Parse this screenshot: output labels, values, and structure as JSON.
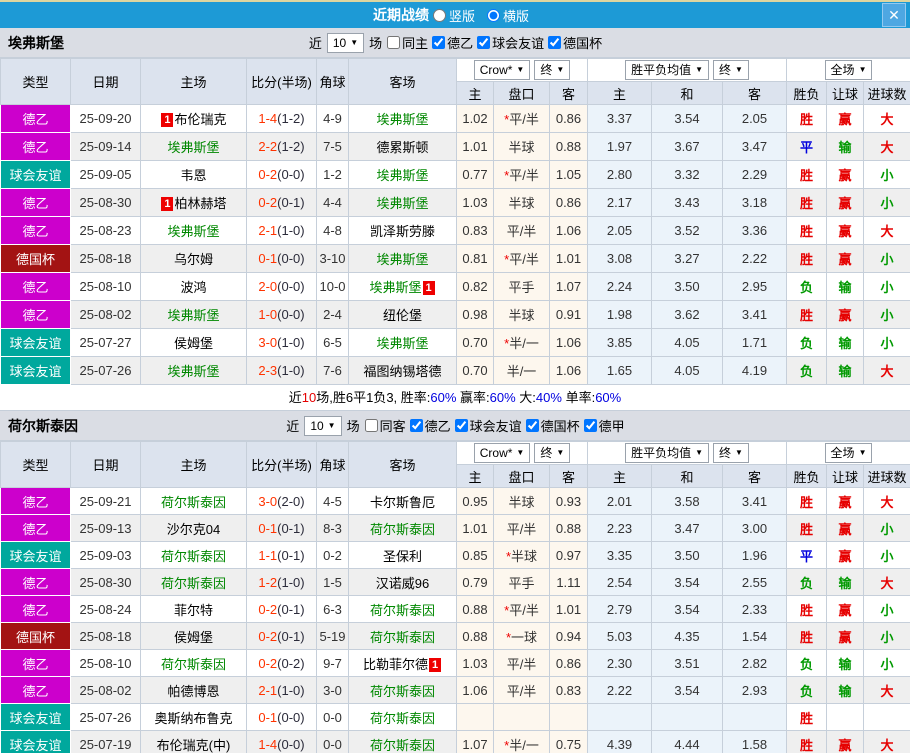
{
  "titlebar": {
    "title": "近期战绩",
    "radios": [
      {
        "label": "竖版",
        "checked": false
      },
      {
        "label": "横版",
        "checked": true
      }
    ],
    "close_label": "✕"
  },
  "table_header": {
    "left_cols": [
      "类型",
      "日期",
      "主场",
      "比分(半场)",
      "角球",
      "客场"
    ],
    "groups": [
      {
        "dropdowns": [
          "Crow*",
          "终"
        ],
        "cols": [
          "主",
          "盘口",
          "客"
        ]
      },
      {
        "dropdowns": [
          "胜平负均值",
          "终"
        ],
        "cols": [
          "主",
          "和",
          "客"
        ]
      },
      {
        "dropdowns": [
          "全场"
        ],
        "cols": [
          "胜负",
          "让球",
          "进球数"
        ]
      }
    ]
  },
  "colors": {
    "titlebar_bg": "#1d9ad6",
    "type": {
      "德乙": "#cc00cc",
      "球会友谊": "#00a89d",
      "德国杯": "#a31313",
      "德甲": "#e07000"
    },
    "team_green": "#008800",
    "team_black": "#000000",
    "score_red": "#ff3300",
    "outcome": {
      "胜": "#e60000",
      "平": "#0000dd",
      "负": "#009900",
      "赢": "#e60000",
      "输": "#009900",
      "大": "#e60000",
      "小": "#009900"
    },
    "summary_value_blue": "#0000e0",
    "odds_bg": "#fdf7ee",
    "avg_bg": "#ebf3fa"
  },
  "sections": [
    {
      "team": "埃弗斯堡",
      "filters": {
        "near_label": "近",
        "count": "10",
        "games_label": "场",
        "same_label": "同主",
        "same_checked": false,
        "leagues": [
          {
            "label": "德乙",
            "checked": true
          },
          {
            "label": "球会友谊",
            "checked": true
          },
          {
            "label": "德国杯",
            "checked": true
          }
        ]
      },
      "rows": [
        {
          "type": "德乙",
          "date": "25-09-20",
          "home": "布伦瑞克",
          "home_green": false,
          "home_badge": "1",
          "score": "1-4",
          "half": "(1-2)",
          "corners": "4-9",
          "away": "埃弗斯堡",
          "away_green": true,
          "away_badge": "",
          "odds": [
            "1.02",
            "*平/半",
            "0.86"
          ],
          "avg": [
            "3.37",
            "3.54",
            "2.05"
          ],
          "results": [
            "胜",
            "赢",
            "大"
          ]
        },
        {
          "type": "德乙",
          "date": "25-09-14",
          "home": "埃弗斯堡",
          "home_green": true,
          "home_badge": "",
          "score": "2-2",
          "half": "(1-2)",
          "corners": "7-5",
          "away": "德累斯顿",
          "away_green": false,
          "away_badge": "",
          "odds": [
            "1.01",
            "半球",
            "0.88"
          ],
          "avg": [
            "1.97",
            "3.67",
            "3.47"
          ],
          "results": [
            "平",
            "输",
            "大"
          ]
        },
        {
          "type": "球会友谊",
          "date": "25-09-05",
          "home": "韦恩",
          "home_green": false,
          "home_badge": "",
          "score": "0-2",
          "half": "(0-0)",
          "corners": "1-2",
          "away": "埃弗斯堡",
          "away_green": true,
          "away_badge": "",
          "odds": [
            "0.77",
            "*平/半",
            "1.05"
          ],
          "avg": [
            "2.80",
            "3.32",
            "2.29"
          ],
          "results": [
            "胜",
            "赢",
            "小"
          ]
        },
        {
          "type": "德乙",
          "date": "25-08-30",
          "home": "柏林赫塔",
          "home_green": false,
          "home_badge": "1",
          "score": "0-2",
          "half": "(0-1)",
          "corners": "4-4",
          "away": "埃弗斯堡",
          "away_green": true,
          "away_badge": "",
          "odds": [
            "1.03",
            "半球",
            "0.86"
          ],
          "avg": [
            "2.17",
            "3.43",
            "3.18"
          ],
          "results": [
            "胜",
            "赢",
            "小"
          ]
        },
        {
          "type": "德乙",
          "date": "25-08-23",
          "home": "埃弗斯堡",
          "home_green": true,
          "home_badge": "",
          "score": "2-1",
          "half": "(1-0)",
          "corners": "4-8",
          "away": "凯泽斯劳滕",
          "away_green": false,
          "away_badge": "",
          "odds": [
            "0.83",
            "平/半",
            "1.06"
          ],
          "avg": [
            "2.05",
            "3.52",
            "3.36"
          ],
          "results": [
            "胜",
            "赢",
            "大"
          ]
        },
        {
          "type": "德国杯",
          "date": "25-08-18",
          "home": "乌尔姆",
          "home_green": false,
          "home_badge": "",
          "score": "0-1",
          "half": "(0-0)",
          "corners": "3-10",
          "away": "埃弗斯堡",
          "away_green": true,
          "away_badge": "",
          "odds": [
            "0.81",
            "*平/半",
            "1.01"
          ],
          "avg": [
            "3.08",
            "3.27",
            "2.22"
          ],
          "results": [
            "胜",
            "赢",
            "小"
          ]
        },
        {
          "type": "德乙",
          "date": "25-08-10",
          "home": "波鸿",
          "home_green": false,
          "home_badge": "",
          "score": "2-0",
          "half": "(0-0)",
          "corners": "10-0",
          "away": "埃弗斯堡",
          "away_green": true,
          "away_badge": "1",
          "odds": [
            "0.82",
            "平手",
            "1.07"
          ],
          "avg": [
            "2.24",
            "3.50",
            "2.95"
          ],
          "results": [
            "负",
            "输",
            "小"
          ]
        },
        {
          "type": "德乙",
          "date": "25-08-02",
          "home": "埃弗斯堡",
          "home_green": true,
          "home_badge": "",
          "score": "1-0",
          "half": "(0-0)",
          "corners": "2-4",
          "away": "纽伦堡",
          "away_green": false,
          "away_badge": "",
          "odds": [
            "0.98",
            "半球",
            "0.91"
          ],
          "avg": [
            "1.98",
            "3.62",
            "3.41"
          ],
          "results": [
            "胜",
            "赢",
            "小"
          ]
        },
        {
          "type": "球会友谊",
          "date": "25-07-27",
          "home": "侯姆堡",
          "home_green": false,
          "home_badge": "",
          "score": "3-0",
          "half": "(1-0)",
          "corners": "6-5",
          "away": "埃弗斯堡",
          "away_green": true,
          "away_badge": "",
          "odds": [
            "0.70",
            "*半/一",
            "1.06"
          ],
          "avg": [
            "3.85",
            "4.05",
            "1.71"
          ],
          "results": [
            "负",
            "输",
            "小"
          ]
        },
        {
          "type": "球会友谊",
          "date": "25-07-26",
          "home": "埃弗斯堡",
          "home_green": true,
          "home_badge": "",
          "score": "2-3",
          "half": "(1-0)",
          "corners": "7-6",
          "away": "福图纳锡塔德",
          "away_green": false,
          "away_badge": "",
          "odds": [
            "0.70",
            "半/一",
            "1.06"
          ],
          "avg": [
            "1.65",
            "4.05",
            "4.19"
          ],
          "results": [
            "负",
            "输",
            "大"
          ]
        }
      ],
      "summary_segments": [
        {
          "t": "近",
          "c": "k"
        },
        {
          "t": "10",
          "c": "r"
        },
        {
          "t": "场,胜6平1负3, 胜率:",
          "c": "k"
        },
        {
          "t": "60%",
          "c": "b"
        },
        {
          "t": " 赢率:",
          "c": "k"
        },
        {
          "t": "60%",
          "c": "b"
        },
        {
          "t": " 大:",
          "c": "k"
        },
        {
          "t": "40%",
          "c": "b"
        },
        {
          "t": " 单率:",
          "c": "k"
        },
        {
          "t": "60%",
          "c": "b"
        }
      ]
    },
    {
      "team": "荷尔斯泰因",
      "filters": {
        "near_label": "近",
        "count": "10",
        "games_label": "场",
        "same_label": "同客",
        "same_checked": false,
        "leagues": [
          {
            "label": "德乙",
            "checked": true
          },
          {
            "label": "球会友谊",
            "checked": true
          },
          {
            "label": "德国杯",
            "checked": true
          },
          {
            "label": "德甲",
            "checked": true
          }
        ]
      },
      "rows": [
        {
          "type": "德乙",
          "date": "25-09-21",
          "home": "荷尔斯泰因",
          "home_green": true,
          "home_badge": "",
          "score": "3-0",
          "half": "(2-0)",
          "corners": "4-5",
          "away": "卡尔斯鲁厄",
          "away_green": false,
          "away_badge": "",
          "odds": [
            "0.95",
            "半球",
            "0.93"
          ],
          "avg": [
            "2.01",
            "3.58",
            "3.41"
          ],
          "results": [
            "胜",
            "赢",
            "大"
          ]
        },
        {
          "type": "德乙",
          "date": "25-09-13",
          "home": "沙尔克04",
          "home_green": false,
          "home_badge": "",
          "score": "0-1",
          "half": "(0-1)",
          "corners": "8-3",
          "away": "荷尔斯泰因",
          "away_green": true,
          "away_badge": "",
          "odds": [
            "1.01",
            "平/半",
            "0.88"
          ],
          "avg": [
            "2.23",
            "3.47",
            "3.00"
          ],
          "results": [
            "胜",
            "赢",
            "小"
          ]
        },
        {
          "type": "球会友谊",
          "date": "25-09-03",
          "home": "荷尔斯泰因",
          "home_green": true,
          "home_badge": "",
          "score": "1-1",
          "half": "(0-1)",
          "corners": "0-2",
          "away": "圣保利",
          "away_green": false,
          "away_badge": "",
          "odds": [
            "0.85",
            "*半球",
            "0.97"
          ],
          "avg": [
            "3.35",
            "3.50",
            "1.96"
          ],
          "results": [
            "平",
            "赢",
            "小"
          ]
        },
        {
          "type": "德乙",
          "date": "25-08-30",
          "home": "荷尔斯泰因",
          "home_green": true,
          "home_badge": "",
          "score": "1-2",
          "half": "(1-0)",
          "corners": "1-5",
          "away": "汉诺威96",
          "away_green": false,
          "away_badge": "",
          "odds": [
            "0.79",
            "平手",
            "1.11"
          ],
          "avg": [
            "2.54",
            "3.54",
            "2.55"
          ],
          "results": [
            "负",
            "输",
            "大"
          ]
        },
        {
          "type": "德乙",
          "date": "25-08-24",
          "home": "菲尔特",
          "home_green": false,
          "home_badge": "",
          "score": "0-2",
          "half": "(0-1)",
          "corners": "6-3",
          "away": "荷尔斯泰因",
          "away_green": true,
          "away_badge": "",
          "odds": [
            "0.88",
            "*平/半",
            "1.01"
          ],
          "avg": [
            "2.79",
            "3.54",
            "2.33"
          ],
          "results": [
            "胜",
            "赢",
            "小"
          ]
        },
        {
          "type": "德国杯",
          "date": "25-08-18",
          "home": "侯姆堡",
          "home_green": false,
          "home_badge": "",
          "score": "0-2",
          "half": "(0-1)",
          "corners": "5-19",
          "away": "荷尔斯泰因",
          "away_green": true,
          "away_badge": "",
          "odds": [
            "0.88",
            "*一球",
            "0.94"
          ],
          "avg": [
            "5.03",
            "4.35",
            "1.54"
          ],
          "results": [
            "胜",
            "赢",
            "小"
          ]
        },
        {
          "type": "德乙",
          "date": "25-08-10",
          "home": "荷尔斯泰因",
          "home_green": true,
          "home_badge": "",
          "score": "0-2",
          "half": "(0-2)",
          "corners": "9-7",
          "away": "比勒菲尔德",
          "away_green": false,
          "away_badge": "1",
          "odds": [
            "1.03",
            "平/半",
            "0.86"
          ],
          "avg": [
            "2.30",
            "3.51",
            "2.82"
          ],
          "results": [
            "负",
            "输",
            "小"
          ]
        },
        {
          "type": "德乙",
          "date": "25-08-02",
          "home": "帕德博恩",
          "home_green": false,
          "home_badge": "",
          "score": "2-1",
          "half": "(1-0)",
          "corners": "3-0",
          "away": "荷尔斯泰因",
          "away_green": true,
          "away_badge": "",
          "odds": [
            "1.06",
            "平/半",
            "0.83"
          ],
          "avg": [
            "2.22",
            "3.54",
            "2.93"
          ],
          "results": [
            "负",
            "输",
            "大"
          ]
        },
        {
          "type": "球会友谊",
          "date": "25-07-26",
          "home": "奥斯纳布鲁克",
          "home_green": false,
          "home_badge": "",
          "score": "0-1",
          "half": "(0-0)",
          "corners": "0-0",
          "away": "荷尔斯泰因",
          "away_green": true,
          "away_badge": "",
          "odds": [
            "",
            "",
            ""
          ],
          "avg": [
            "",
            "",
            ""
          ],
          "results": [
            "胜",
            "",
            ""
          ]
        },
        {
          "type": "球会友谊",
          "date": "25-07-19",
          "home": "布伦瑞克(中)",
          "home_green": false,
          "home_badge": "",
          "score": "1-4",
          "half": "(0-0)",
          "corners": "0-0",
          "away": "荷尔斯泰因",
          "away_green": true,
          "away_badge": "",
          "odds": [
            "1.07",
            "*半/一",
            "0.75"
          ],
          "avg": [
            "4.39",
            "4.44",
            "1.58"
          ],
          "results": [
            "胜",
            "赢",
            "大"
          ]
        }
      ],
      "summary_segments": null
    }
  ]
}
